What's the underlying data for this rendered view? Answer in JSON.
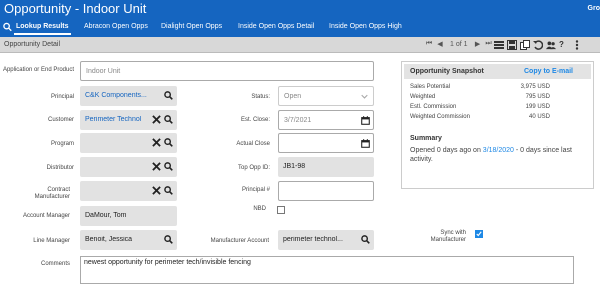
{
  "app": {
    "title": "Opportunity - Indoor Unit",
    "corner": "Gro"
  },
  "tabs": [
    {
      "label": "Lookup Results"
    },
    {
      "label": "Abracon Open Opps"
    },
    {
      "label": "Dialight Open Opps"
    },
    {
      "label": "Inside Open Opps Detail"
    },
    {
      "label": "Inside Open Opps High"
    }
  ],
  "subbar": {
    "label": "Opportunity Detail",
    "pager": "1 of 1"
  },
  "fields": {
    "application_label": "Application or End Product",
    "application_value": "Indoor Unit",
    "principal_label": "Principal",
    "principal_value": "C&K Components...",
    "customer_label": "Customer",
    "customer_value": "Perimeter Technol",
    "program_label": "Program",
    "distributor_label": "Distributor",
    "contract_mfr_label": "Contract Manufacturer",
    "account_manager_label": "Account Manager",
    "account_manager_value": "DaMour, Tom",
    "line_manager_label": "Line Manager",
    "line_manager_value": "Benoit, Jessica",
    "status_label": "Status:",
    "status_value": "Open",
    "est_close_label": "Est. Close:",
    "est_close_value": "3/7/2021",
    "actual_close_label": "Actual Close",
    "top_opp_label": "Top Opp ID:",
    "top_opp_value": "JB1-98",
    "principal_num_label": "Principal #",
    "nbd_label": "NBD",
    "nbd_checked": false,
    "mfr_account_label": "Manufacturer Account",
    "mfr_account_value": "perimeter technol...",
    "sync_label": "Sync with Manufacturer",
    "sync_checked": true,
    "comments_label": "Comments",
    "comments_value": "newest opportunity for perimeter tech/invisible fencing"
  },
  "snapshot": {
    "title": "Opportunity Snapshot",
    "copy_link": "Copy to E-mail",
    "rows": [
      {
        "label": "Sales Potential",
        "value": "3,975 USD"
      },
      {
        "label": "Weighted",
        "value": "795 USD"
      },
      {
        "label": "Estl. Commission",
        "value": "199 USD"
      },
      {
        "label": "Weighted Commission",
        "value": "40 USD"
      }
    ],
    "summary_title": "Summary",
    "summary_pre": "Opened 0 days ago on",
    "summary_date": "3/18/2020",
    "summary_post": "- 0 days since last activity."
  },
  "colors": {
    "brand": "#1565c0",
    "link": "#1e88e5"
  }
}
